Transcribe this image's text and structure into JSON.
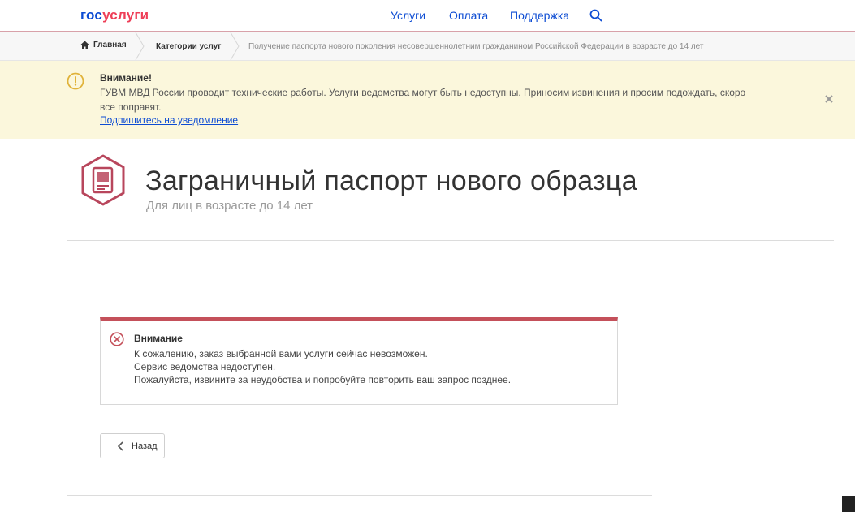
{
  "header": {
    "logo_part1": "гос",
    "logo_part2": "услуги",
    "nav": [
      "Услуги",
      "Оплата",
      "Поддержка"
    ],
    "search_icon": "search-icon"
  },
  "breadcrumb": {
    "home": "Главная",
    "categories": "Категории услуг",
    "current": "Получение паспорта нового поколения несовершеннолетним гражданином Российской Федерации в возрасте до 14 лет"
  },
  "banner": {
    "title": "Внимание!",
    "text": "ГУВМ МВД России проводит технические работы. Услуги ведомства могут быть недоступны. Приносим извинения и просим подождать, скоро все поправят.",
    "link": "Подпишитесь на уведомление",
    "icon": "exclamation-circle-icon",
    "close_icon": "close-icon"
  },
  "service": {
    "title": "Заграничный паспорт нового образца",
    "subtitle": "Для лиц в возрасте до 14 лет",
    "icon": "passport-icon"
  },
  "error": {
    "title": "Внимание",
    "lines": [
      "К сожалению, заказ выбранной вами услуги сейчас невозможен.",
      "Сервис ведомства недоступен.",
      "Пожалуйста, извините за неудобства и попробуйте повторить ваш запрос позднее."
    ],
    "icon": "error-x-circle-icon"
  },
  "back_button": {
    "label": "Назад"
  },
  "colors": {
    "brand_blue": "#0d4cd3",
    "brand_red": "#ee3f58",
    "banner_bg": "#fbf7dc",
    "banner_icon": "#e0b33a",
    "error_accent": "#c4505a",
    "service_icon": "#b8465c"
  }
}
